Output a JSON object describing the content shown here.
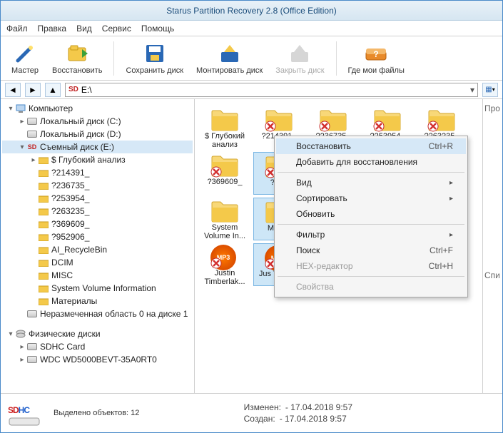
{
  "title": "Starus Partition Recovery 2.8 (Office Edition)",
  "menubar": [
    "Файл",
    "Правка",
    "Вид",
    "Сервис",
    "Помощь"
  ],
  "toolbar": {
    "master": "Мастер",
    "recover": "Восстановить",
    "save_disk": "Сохранить диск",
    "mount_disk": "Монтировать диск",
    "close_disk": "Закрыть диск",
    "where_files": "Где мои файлы"
  },
  "address": {
    "path": "E:\\",
    "logo": "SD"
  },
  "tree": {
    "root1": "Компьютер",
    "local_c": "Локальный диск (C:)",
    "local_d": "Локальный диск (D:)",
    "removable_e": "Съемный диск (E:)",
    "deep": "$ Глубокий анализ",
    "f1": "?214391_",
    "f2": "?236735_",
    "f3": "?253954_",
    "f4": "?263235_",
    "f5": "?369609_",
    "f6": "?952906_",
    "recycle": "AI_RecycleBin",
    "dcim": "DCIM",
    "misc": "MISC",
    "svi": "System Volume Information",
    "materials": "Материалы",
    "unalloc": "Неразмеченная область 0 на диске 1",
    "root2": "Физические диски",
    "sdhc": "SDHC Card",
    "wdc": "WDC WD5000BEVT-35A0RT0"
  },
  "files": [
    {
      "name": "$ Глубокий анализ",
      "type": "folder",
      "del": false
    },
    {
      "name": "?214391_",
      "type": "folder",
      "del": true
    },
    {
      "name": "?236735_",
      "type": "folder",
      "del": true
    },
    {
      "name": "?253954_",
      "type": "folder",
      "del": true
    },
    {
      "name": "?263235_",
      "type": "folder",
      "del": true
    },
    {
      "name": "?369609_",
      "type": "folder",
      "del": true
    },
    {
      "name": "?952",
      "type": "folder",
      "del": true,
      "sel": true
    },
    {
      "name": "",
      "type": "folder",
      "del": false,
      "sel": true
    },
    {
      "name": "",
      "type": "folder",
      "del": false,
      "sel": true
    },
    {
      "name": "",
      "type": "folder",
      "del": false,
      "sel": true
    },
    {
      "name": "System Volume In...",
      "type": "folder",
      "del": false
    },
    {
      "name": "Матер",
      "type": "folder",
      "del": false,
      "sel": true
    },
    {
      "name": "Justin Timberlak...",
      "type": "mp3",
      "del": true
    },
    {
      "name": "Jus Timberl",
      "type": "mp3",
      "del": true,
      "sel": true
    }
  ],
  "side_labels": {
    "prop": "Про",
    "list": "Спи"
  },
  "context_menu": {
    "recover": "Восстановить",
    "recover_sc": "Ctrl+R",
    "add_recover": "Добавить для восстановления",
    "view": "Вид",
    "sort": "Сортировать",
    "refresh": "Обновить",
    "filter": "Фильтр",
    "search": "Поиск",
    "search_sc": "Ctrl+F",
    "hex": "HEX-редактор",
    "hex_sc": "Ctrl+H",
    "props": "Свойства"
  },
  "status": {
    "logo_sd": "SD",
    "logo_hc": "HC",
    "selected": "Выделено объектов: 12",
    "changed_lbl": "Изменен:",
    "changed_val": "- 17.04.2018 9:57",
    "created_lbl": "Создан:",
    "created_val": "- 17.04.2018 9:57"
  }
}
